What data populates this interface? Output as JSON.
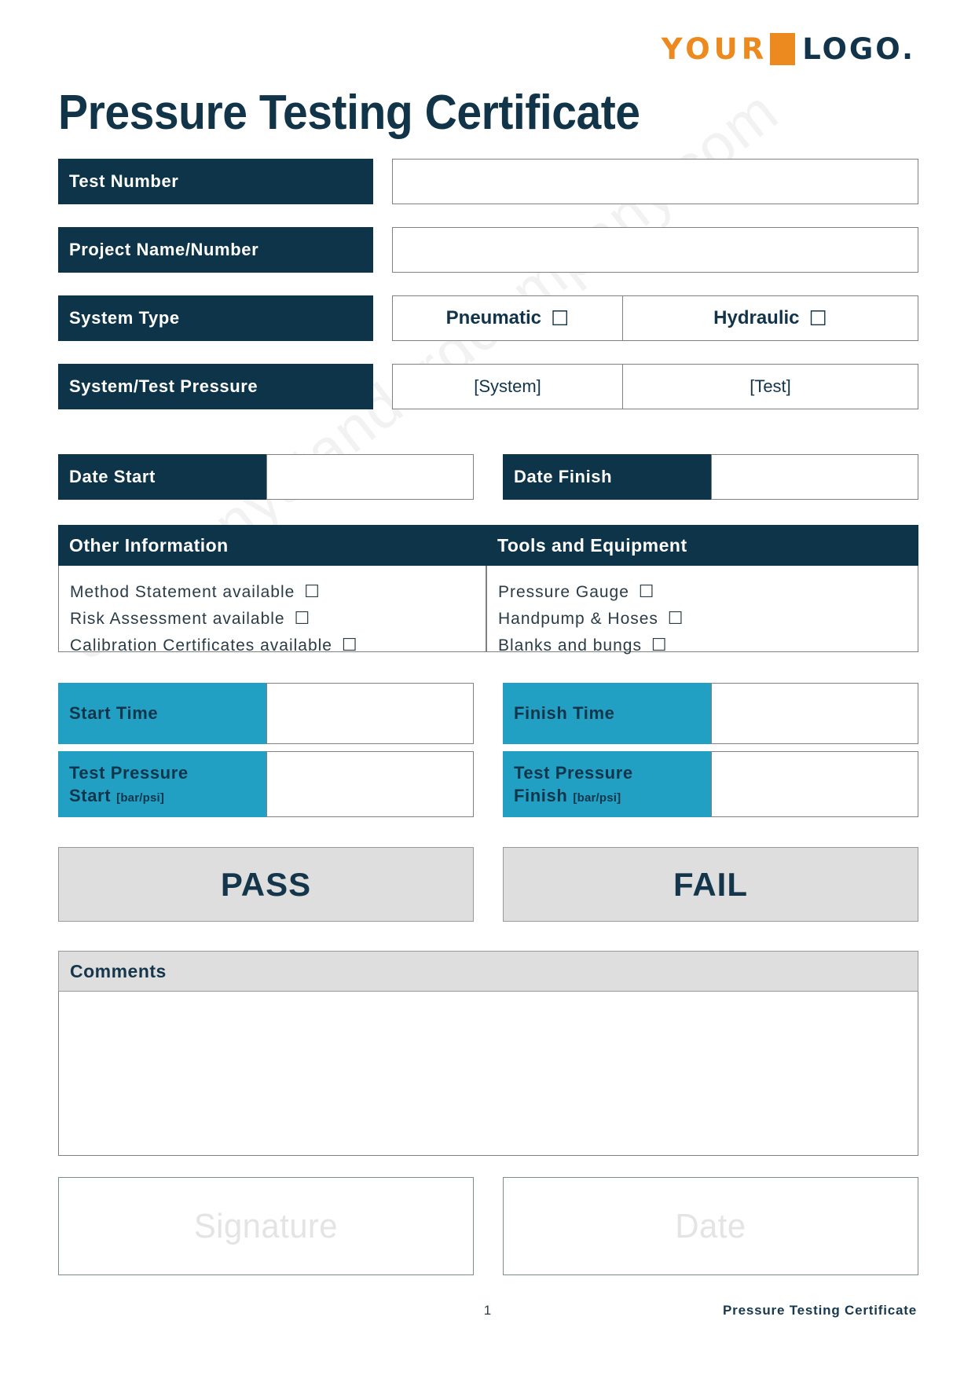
{
  "logo": {
    "word1": "YOUR",
    "word2": "LOGO.",
    "orange": "#ED8A1F",
    "navy": "#12344B"
  },
  "title": "Pressure Testing Certificate",
  "watermark": "companystandardcompany.com",
  "fields": {
    "test_number": {
      "label": "Test Number",
      "value": ""
    },
    "project": {
      "label": "Project Name/Number",
      "value": ""
    },
    "system_type": {
      "label": "System Type",
      "option_a": "Pneumatic",
      "option_b": "Hydraulic",
      "checkbox": "☐"
    },
    "pressure": {
      "label": "System/Test Pressure",
      "system_value": "[System]",
      "test_value": "[Test]"
    },
    "date_start": {
      "label": "Date Start",
      "value": ""
    },
    "date_finish": {
      "label": "Date Finish",
      "value": ""
    },
    "start_time": {
      "label": "Start Time",
      "value": ""
    },
    "finish_time": {
      "label": "Finish Time",
      "value": ""
    },
    "tp_start": {
      "label_line1": "Test Pressure",
      "label_line2": "Start",
      "unit": "[bar/psi]",
      "value": ""
    },
    "tp_finish": {
      "label_line1": "Test Pressure",
      "label_line2": "Finish",
      "unit": "[bar/psi]",
      "value": ""
    }
  },
  "other_information": {
    "heading": "Other Information",
    "items": [
      {
        "label": "Method Statement available",
        "checkbox": "☐"
      },
      {
        "label": "Risk Assessment available",
        "checkbox": "☐"
      },
      {
        "label": "Calibration Certificates available",
        "checkbox": "☐"
      }
    ]
  },
  "tools_equipment": {
    "heading": "Tools and Equipment",
    "items": [
      {
        "label": "Pressure Gauge",
        "checkbox": "☐"
      },
      {
        "label": "Handpump & Hoses",
        "checkbox": "☐"
      },
      {
        "label": "Blanks and bungs",
        "checkbox": "☐"
      }
    ]
  },
  "result": {
    "pass": "PASS",
    "fail": "FAIL"
  },
  "comments": {
    "heading": "Comments",
    "value": ""
  },
  "signoff": {
    "signature_placeholder": "Signature",
    "date_placeholder": "Date"
  },
  "footer": {
    "page": "1",
    "document_name": "Pressure Testing Certificate"
  },
  "colors": {
    "navy": "#0D3449",
    "teal": "#22A0C4",
    "orange": "#ED8A1F",
    "gray": "#DEDEDE"
  }
}
